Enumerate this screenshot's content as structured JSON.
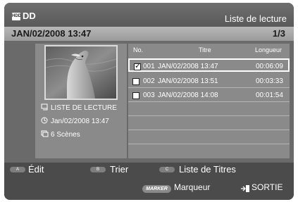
{
  "header": {
    "hdd_badge": "HDD",
    "app_title": "DD",
    "window_title": "Liste de lecture"
  },
  "datebar": {
    "current_date": "JAN/02/2008 13:47",
    "page": "1/3"
  },
  "info": {
    "title": "LISTE DE LECTURE",
    "date": "Jan/02/2008 13:47",
    "scenes": "6 Scènes"
  },
  "table": {
    "headers": {
      "no": "No.",
      "title": "Titre",
      "length": "Longueur"
    },
    "rows": [
      {
        "no": "001",
        "title": "JAN/02/2008 13:47",
        "length": "00:06:09",
        "checked": true
      },
      {
        "no": "002",
        "title": "JAN/02/2008 13:51",
        "length": "00:03:33",
        "checked": false
      },
      {
        "no": "003",
        "title": "JAN/02/2008 14:08",
        "length": "00:01:54",
        "checked": false
      }
    ]
  },
  "footer": {
    "keys": [
      {
        "key": "A",
        "label": "Édit"
      },
      {
        "key": "B",
        "label": "Trier"
      },
      {
        "key": "C",
        "label": "Liste de Titres"
      }
    ],
    "marker_key": "MARKER",
    "marker_label": "Marqueur",
    "exit_label": "SORTIE"
  },
  "colors": {
    "background": "#6a6a6a",
    "panel": "#8a8a8a",
    "datebar": "#a9a9a9",
    "footer": "#4b4b4b"
  }
}
